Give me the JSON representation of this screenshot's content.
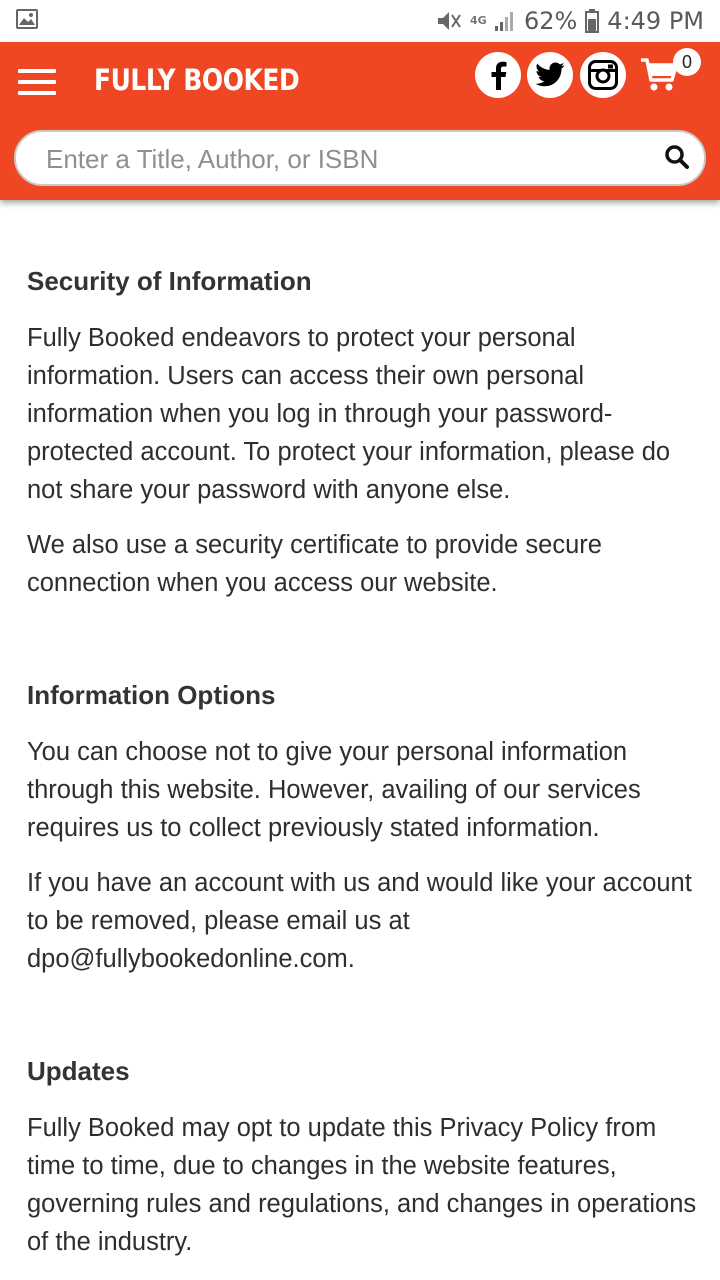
{
  "status_bar": {
    "network": "4G",
    "battery": "62%",
    "time": "4:49 PM"
  },
  "header": {
    "brand": "FULLY BOOKED",
    "social_icons": [
      "facebook-icon",
      "twitter-icon",
      "instagram-icon"
    ],
    "cart_count": "0",
    "accent_color": "#ef4623"
  },
  "search": {
    "placeholder": "Enter a Title, Author, or ISBN",
    "value": ""
  },
  "sections": [
    {
      "heading": "Security of Information",
      "paragraphs": [
        "Fully Booked endeavors to protect your personal information. Users can access their own personal information when you log in through your password-protected account. To protect your information, please do not share your password with anyone else.",
        "We also use a security certificate to provide secure connection when you access our website."
      ]
    },
    {
      "heading": "Information Options",
      "paragraphs": [
        "You can choose not to give your personal information through this website. However, availing of our services requires us to collect previously stated information.",
        "If you have an account with us and would like your account to be removed, please email us at dpo@fullybookedonline.com."
      ]
    },
    {
      "heading": "Updates",
      "paragraphs": [
        "Fully Booked may opt to update this Privacy Policy from time to time, due to changes in the website features, governing rules and regulations, and changes in operations of the industry."
      ]
    }
  ]
}
